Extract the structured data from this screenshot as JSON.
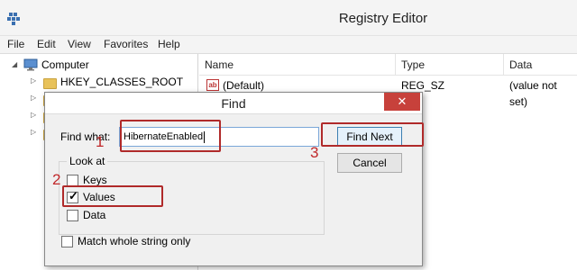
{
  "window": {
    "title": "Registry Editor",
    "icon": "registry-editor-icon"
  },
  "menubar": {
    "items": [
      "File",
      "Edit",
      "View",
      "Favorites",
      "Help"
    ]
  },
  "tree": {
    "root": "Computer",
    "items": [
      "HKEY_CLASSES_ROOT"
    ]
  },
  "list": {
    "headers": [
      "Name",
      "Type",
      "Data"
    ],
    "rows": [
      {
        "name": "(Default)",
        "type": "REG_SZ",
        "data": "(value not set)"
      }
    ]
  },
  "dialog": {
    "title": "Find",
    "close_label": "✕",
    "find_what_label": "Find what:",
    "find_what_value": "HibernateEnabled",
    "look_at_label": "Look at",
    "keys_label": "Keys",
    "values_label": "Values",
    "data_label": "Data",
    "keys_checked": false,
    "values_checked": true,
    "data_checked": false,
    "match_whole_label": "Match whole string only",
    "match_whole_checked": false,
    "find_next_label": "Find Next",
    "cancel_label": "Cancel"
  },
  "annotations": {
    "step1": "1",
    "step2": "2",
    "step3": "3",
    "color": "#c0282a"
  },
  "colors": {
    "close_button": "#c7413b",
    "folder": "#e8c25a"
  }
}
